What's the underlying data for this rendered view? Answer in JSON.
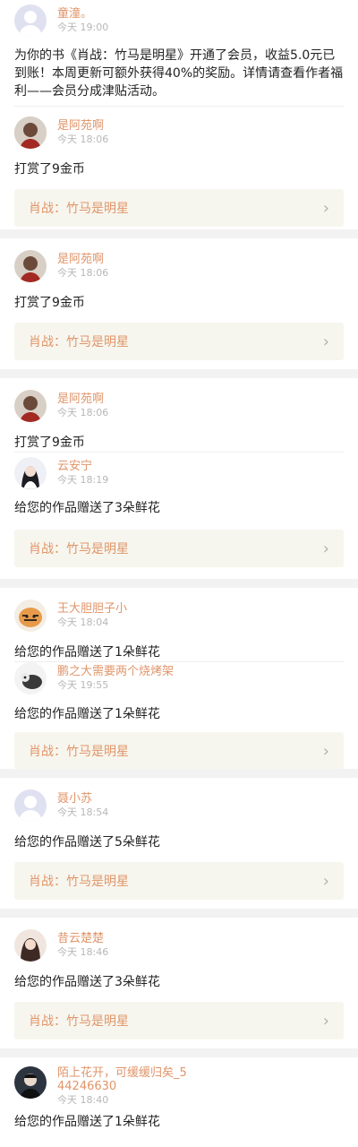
{
  "system_notice": {
    "name": "童潼。",
    "time": "今天 19:00",
    "body": "为你的书《肖战：竹马是明星》开通了会员，收益5.0元已到账！本周更新可额外获得40%的奖励。详情请查看作者福利——会员分成津贴活动。"
  },
  "book_title": "肖战：竹马是明星",
  "icons": {
    "chevron": "chevron-right-icon"
  },
  "colors": {
    "name": "#e0956a",
    "time": "#b7b7b7",
    "book_bg": "#f7f6ee"
  },
  "cards": [
    {
      "messages": [
        {
          "name": "是阿苑啊",
          "time": "今天 18:06",
          "text": "打赏了9金币"
        }
      ],
      "book": "肖战：竹马是明星"
    },
    {
      "messages": [
        {
          "name": "是阿苑啊",
          "time": "今天 18:06",
          "text": "打赏了9金币"
        }
      ],
      "book": "肖战：竹马是明星"
    },
    {
      "messages": [
        {
          "name": "是阿苑啊",
          "time": "今天 18:06",
          "text": "打赏了9金币"
        },
        {
          "name": "云安宁",
          "time": "今天 18:19",
          "text": "给您的作品赠送了3朵鲜花"
        }
      ],
      "book": "肖战：竹马是明星"
    },
    {
      "messages": [
        {
          "name": "王大胆胆子小",
          "time": "今天 18:04",
          "text": "给您的作品赠送了1朵鲜花"
        },
        {
          "name": "鹏之大需要两个烧烤架",
          "time": "今天 19:55",
          "text": "给您的作品赠送了1朵鲜花"
        }
      ],
      "book": "肖战：竹马是明星"
    },
    {
      "messages": [
        {
          "name": "聂小苏",
          "time": "今天 18:54",
          "text": "给您的作品赠送了5朵鲜花"
        }
      ],
      "book": "肖战：竹马是明星"
    },
    {
      "messages": [
        {
          "name": "昔云楚楚",
          "time": "今天 18:46",
          "text": "给您的作品赠送了3朵鲜花"
        }
      ],
      "book": "肖战：竹马是明星"
    },
    {
      "messages": [
        {
          "name": "陌上花开，可缓缓归矣_544246630",
          "time": "今天 18:40",
          "text": "给您的作品赠送了1朵鲜花"
        }
      ]
    }
  ]
}
